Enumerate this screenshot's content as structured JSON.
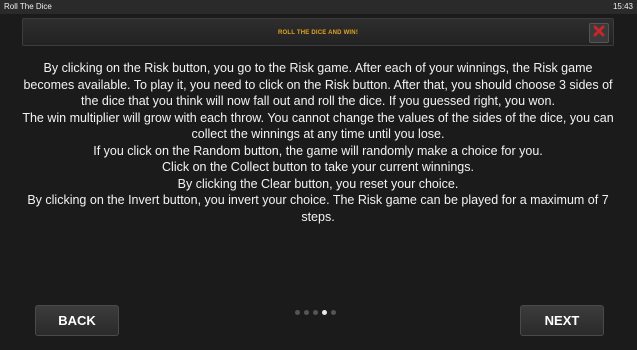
{
  "statusbar": {
    "app_title": "Roll The Dice",
    "clock": "15:43"
  },
  "header": {
    "title": "ROLL THE DICE AND WIN!"
  },
  "info": {
    "paragraphs": [
      "By clicking on the Risk button, you go to the Risk game. After each of your winnings, the Risk game becomes available. To play it, you need to click on the Risk button. After that, you should choose 3 sides of the dice that you think will now fall out and roll the dice. If you guessed right, you won.",
      "The win multiplier will grow with each throw. You cannot change the values of the sides of the dice, you can collect the winnings at any time until you lose.",
      "If you click on the Random button, the game will randomly make a choice for you.",
      "Click on the Collect button to take your current winnings.",
      "By clicking the Clear button, you reset your choice.",
      "By clicking on the Invert button, you invert your choice. The Risk game can be played for a maximum of 7 steps."
    ]
  },
  "pagination": {
    "total": 5,
    "current": 4
  },
  "buttons": {
    "back_label": "BACK",
    "next_label": "NEXT"
  },
  "colors": {
    "accent": "#e0a321",
    "close_red": "#c8262c",
    "background": "#1b1b1b"
  }
}
